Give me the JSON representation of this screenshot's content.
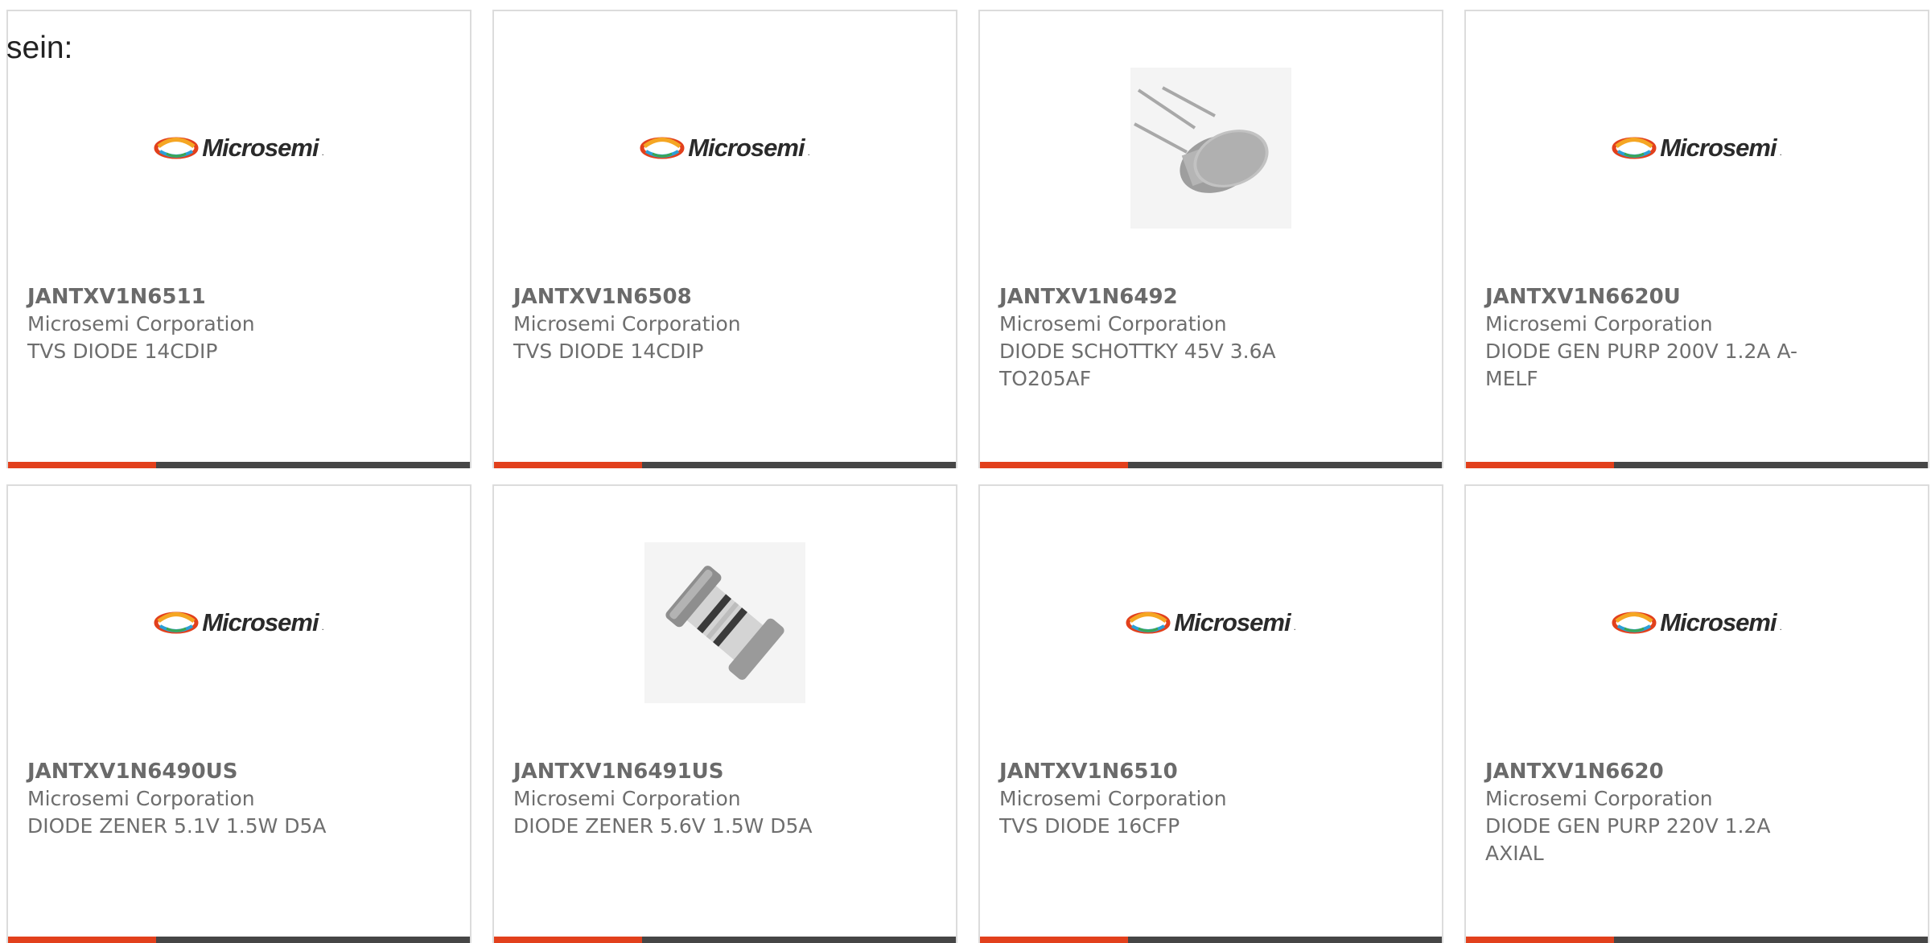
{
  "page": {
    "label": "sein:"
  },
  "logo": {
    "text": "Microsemi",
    "colors": [
      "#e2401c",
      "#f5a623",
      "#2b9fd6",
      "#3aa655"
    ]
  },
  "colors": {
    "accent_bar": "#e2401c",
    "dark_bar": "#464646",
    "card_border": "#dcdcdc",
    "text": "#6e6e6e"
  },
  "products": [
    {
      "part_number": "JANTXV1N6511",
      "manufacturer": "Microsemi Corporation",
      "description": "TVS DIODE 14CDIP",
      "image": "microsemi-logo"
    },
    {
      "part_number": "JANTXV1N6508",
      "manufacturer": "Microsemi Corporation",
      "description": "TVS DIODE 14CDIP",
      "image": "microsemi-logo"
    },
    {
      "part_number": "JANTXV1N6492",
      "manufacturer": "Microsemi Corporation",
      "description": "DIODE SCHOTTKY 45V 3.6A TO205AF",
      "image": "to-can-photo"
    },
    {
      "part_number": "JANTXV1N6620U",
      "manufacturer": "Microsemi Corporation",
      "description": "DIODE GEN PURP 200V 1.2A A-MELF",
      "image": "microsemi-logo"
    },
    {
      "part_number": "JANTXV1N6490US",
      "manufacturer": "Microsemi Corporation",
      "description": "DIODE ZENER 5.1V 1.5W D5A",
      "image": "microsemi-logo"
    },
    {
      "part_number": "JANTXV1N6491US",
      "manufacturer": "Microsemi Corporation",
      "description": "DIODE ZENER 5.6V 1.5W D5A",
      "image": "melf-photo"
    },
    {
      "part_number": "JANTXV1N6510",
      "manufacturer": "Microsemi Corporation",
      "description": "TVS DIODE 16CFP",
      "image": "microsemi-logo"
    },
    {
      "part_number": "JANTXV1N6620",
      "manufacturer": "Microsemi Corporation",
      "description": "DIODE GEN PURP 220V 1.2A AXIAL",
      "image": "microsemi-logo"
    }
  ]
}
